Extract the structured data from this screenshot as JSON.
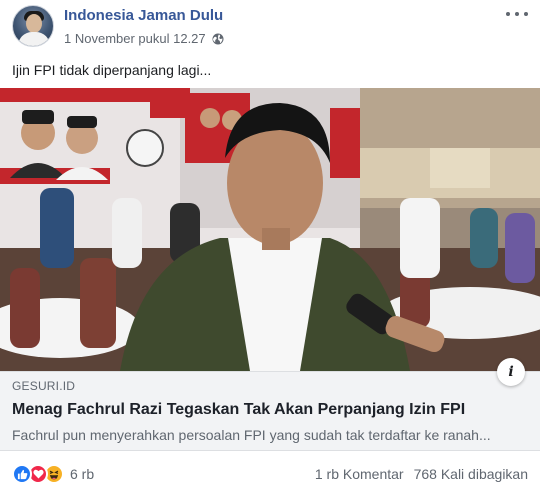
{
  "header": {
    "page_name": "Indonesia Jaman Dulu",
    "timestamp": "1 November pukul 12.27",
    "privacy_icon": "globe-icon",
    "menu_icon": "more-options-icon"
  },
  "post_text": "Ijin FPI tidak diperpanjang lagi...",
  "link_preview": {
    "source": "GESURI.ID",
    "title": "Menag Fachrul Razi Tegaskan Tak Akan Perpanjang Izin FPI",
    "description": "Fachrul pun menyerahkan persoalan FPI yang sudah tak terdaftar ke ranah...",
    "info_label": "i"
  },
  "footer": {
    "reaction_icons": [
      "like-icon",
      "love-icon",
      "haha-icon"
    ],
    "reaction_count": "6 rb",
    "comments": "1 rb Komentar",
    "shares": "768 Kali dibagikan"
  },
  "colors": {
    "page_name": "#385898",
    "meta_text": "#606770",
    "link_bg": "#f2f3f5",
    "like": "#2078f4",
    "love": "#f0284a",
    "haha": "#f7b125"
  }
}
